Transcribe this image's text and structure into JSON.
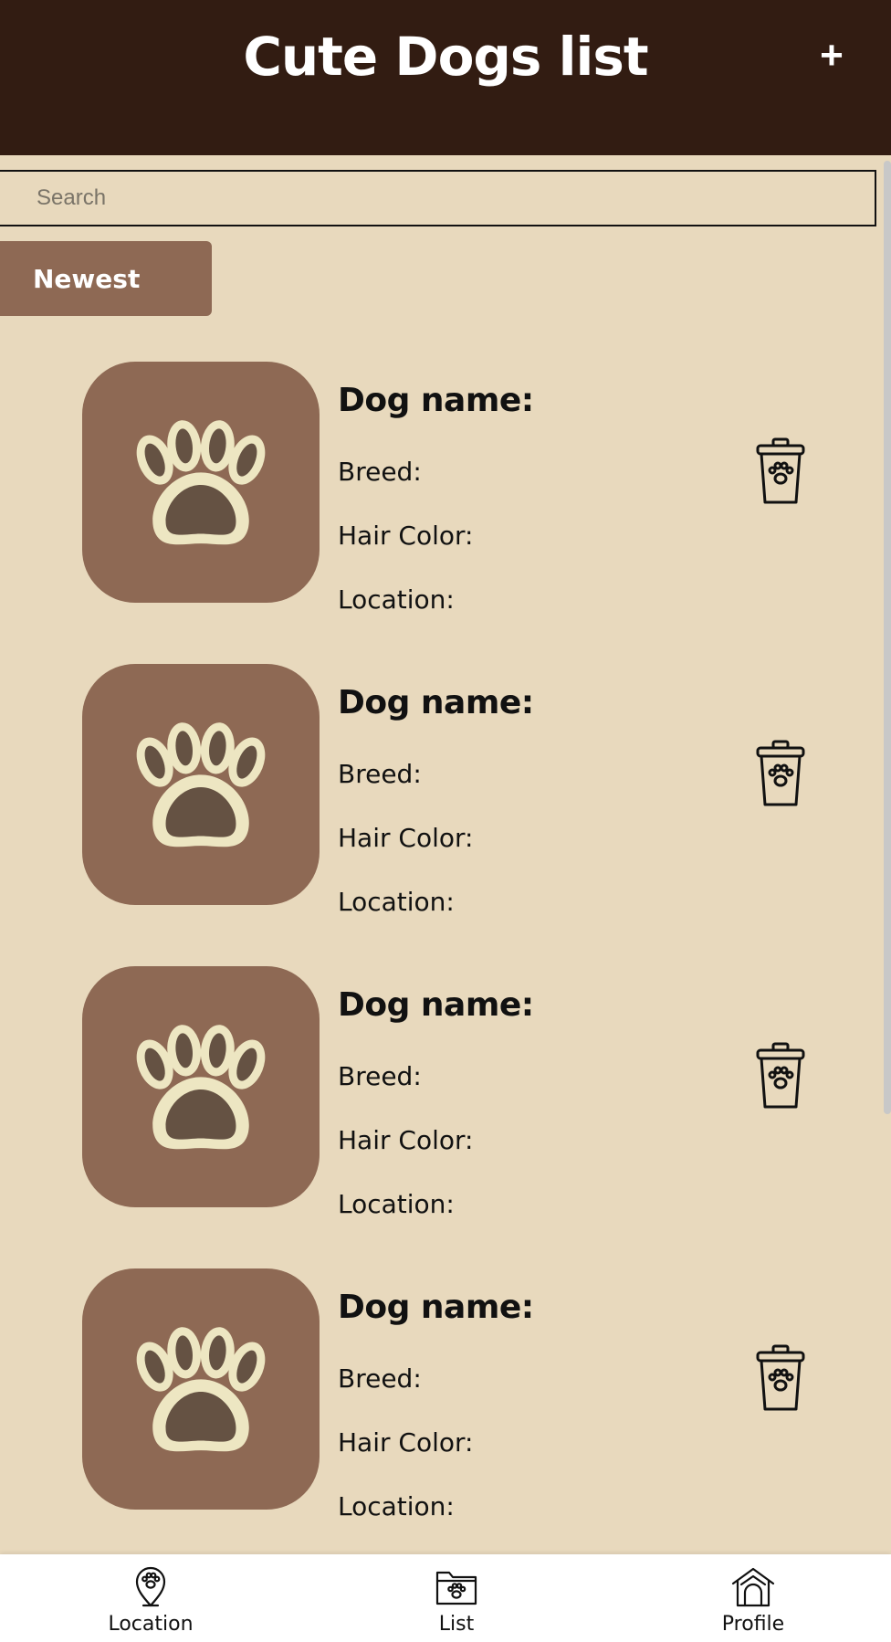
{
  "header": {
    "title": "Cute Dogs list",
    "add_label": "+"
  },
  "search": {
    "placeholder": "Search"
  },
  "sort": {
    "label": "Newest"
  },
  "dogs": [
    {
      "name_label": "Dog name:",
      "breed_label": "Breed:",
      "hair_label": "Hair Color:",
      "location_label": "Location:"
    },
    {
      "name_label": "Dog name:",
      "breed_label": "Breed:",
      "hair_label": "Hair Color:",
      "location_label": "Location:"
    },
    {
      "name_label": "Dog name:",
      "breed_label": "Breed:",
      "hair_label": "Hair Color:",
      "location_label": "Location:"
    },
    {
      "name_label": "Dog name:",
      "breed_label": "Breed:",
      "hair_label": "Hair Color:",
      "location_label": "Location:"
    }
  ],
  "nav": {
    "items": [
      {
        "label": "Location",
        "icon": "location-pin-paw-icon"
      },
      {
        "label": "List",
        "icon": "folder-paw-icon"
      },
      {
        "label": "Profile",
        "icon": "dog-house-icon"
      }
    ]
  },
  "colors": {
    "header_bg": "#321c12",
    "page_bg": "#e8d9bd",
    "accent_brown": "#8e6954",
    "paw_fill": "#ede6c2",
    "paw_inner": "#655243"
  }
}
